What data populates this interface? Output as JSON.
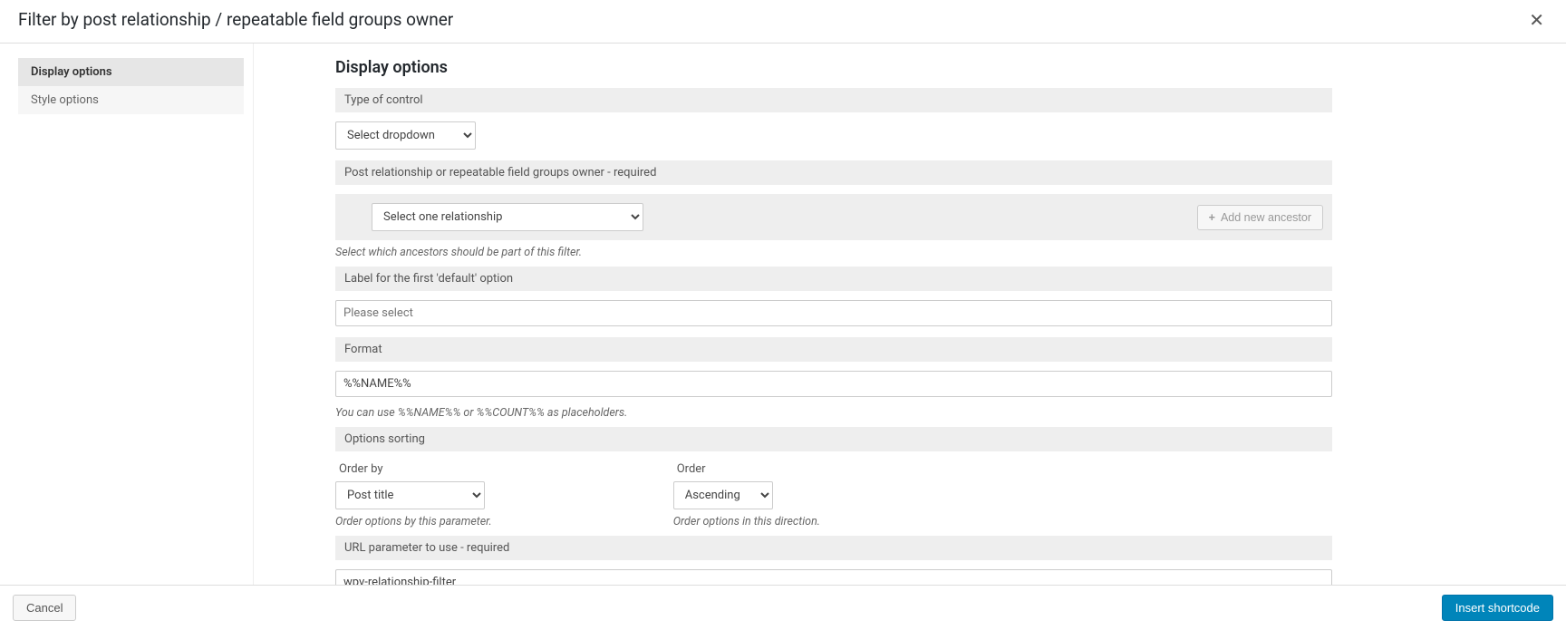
{
  "header": {
    "title": "Filter by post relationship / repeatable field groups owner",
    "close_glyph": "✕"
  },
  "sidebar": {
    "tabs": [
      {
        "label": "Display options",
        "active": true
      },
      {
        "label": "Style options",
        "active": false
      }
    ]
  },
  "main": {
    "heading": "Display options",
    "type_of_control": {
      "section_label": "Type of control",
      "value": "Select dropdown"
    },
    "relationship": {
      "section_label": "Post relationship or repeatable field groups owner - required",
      "select_value": "Select one relationship",
      "add_button": "Add new ancestor",
      "hint": "Select which ancestors should be part of this filter."
    },
    "default_label": {
      "section_label": "Label for the first 'default' option",
      "placeholder": "Please select",
      "value": ""
    },
    "format": {
      "section_label": "Format",
      "value": "%%NAME%%",
      "hint": "You can use %%NAME%% or %%COUNT%% as placeholders."
    },
    "sorting": {
      "section_label": "Options sorting",
      "orderby_label": "Order by",
      "orderby_value": "Post title",
      "orderby_hint": "Order options by this parameter.",
      "order_label": "Order",
      "order_value": "Ascending",
      "order_hint": "Order options in this direction."
    },
    "url_param": {
      "section_label": "URL parameter to use - required",
      "value": "wpv-relationship-filter"
    }
  },
  "footer": {
    "cancel": "Cancel",
    "submit": "Insert shortcode"
  }
}
